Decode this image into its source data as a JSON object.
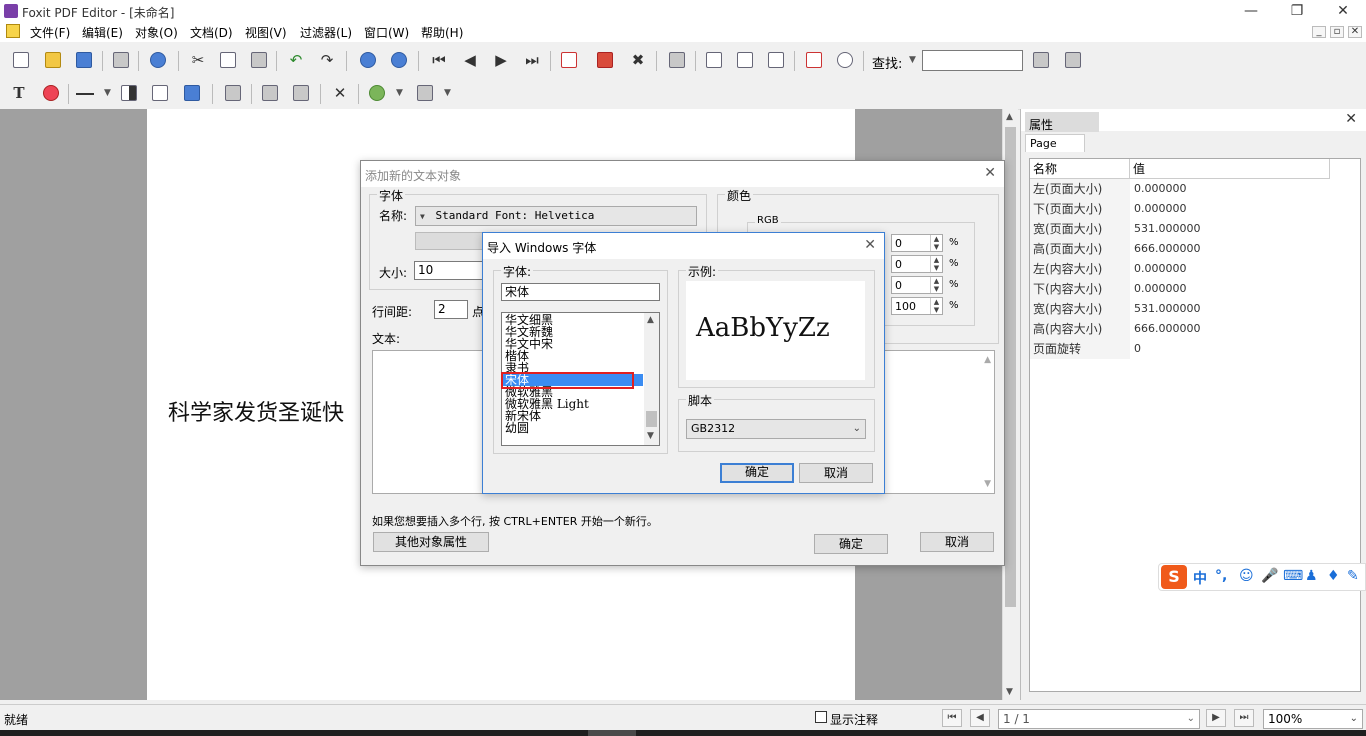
{
  "window": {
    "title": "Foxit PDF Editor - [未命名]"
  },
  "menu": [
    "文件(F)",
    "编辑(E)",
    "对象(O)",
    "文档(D)",
    "视图(V)",
    "过滤器(L)",
    "窗口(W)",
    "帮助(H)"
  ],
  "toolbar": {
    "search_label": "查找:",
    "search_value": ""
  },
  "page": {
    "text": "科学家发货圣诞快"
  },
  "props_panel": {
    "title": "属性",
    "tab": "Page",
    "col_name": "名称",
    "col_value": "值",
    "rows": [
      {
        "name": "左(页面大小)",
        "value": "0.000000"
      },
      {
        "name": "下(页面大小)",
        "value": "0.000000"
      },
      {
        "name": "宽(页面大小)",
        "value": "531.000000"
      },
      {
        "name": "高(页面大小)",
        "value": "666.000000"
      },
      {
        "name": "左(内容大小)",
        "value": "0.000000"
      },
      {
        "name": "下(内容大小)",
        "value": "0.000000"
      },
      {
        "name": "宽(内容大小)",
        "value": "531.000000"
      },
      {
        "name": "高(内容大小)",
        "value": "666.000000"
      },
      {
        "name": "页面旋转",
        "value": "0"
      }
    ]
  },
  "add_text_dialog": {
    "title": "添加新的文本对象",
    "font_group": "字体",
    "name_label": "名称:",
    "font_value": "Standard Font: Helvetica",
    "size_label": "大小:",
    "size_value": "10",
    "line_spacing_label": "行间距:",
    "line_spacing_value": "2",
    "line_spacing_unit": "点",
    "color_group": "颜色",
    "rgb_label": "RGB",
    "rgb_values": [
      "0",
      "0",
      "0",
      "100"
    ],
    "percent": "%",
    "text_label": "文本:",
    "hint": "如果您想要插入多个行, 按 CTRL+ENTER 开始一个新行。",
    "other_props_btn": "其他对象属性",
    "ok_btn": "确定",
    "cancel_btn": "取消"
  },
  "import_font_dialog": {
    "title": "导入 Windows 字体",
    "font_label": "字体:",
    "font_value": "宋体",
    "fonts": [
      "华文细黑",
      "华文新魏",
      "华文中宋",
      "楷体",
      "隶书",
      "宋体",
      "微软雅黑",
      "微软雅黑 Light",
      "新宋体",
      "幼圆"
    ],
    "selected_index": 5,
    "sample_label": "示例:",
    "sample_text": "AaBbYyZz",
    "script_label": "脚本",
    "script_value": "GB2312",
    "ok_btn": "确定",
    "cancel_btn": "取消"
  },
  "statusbar": {
    "status": "就绪",
    "show_annotations": "显示注释",
    "page_field": "1 / 1",
    "zoom": "100%"
  },
  "ime": {
    "mode": "中",
    "punct": "°,"
  }
}
